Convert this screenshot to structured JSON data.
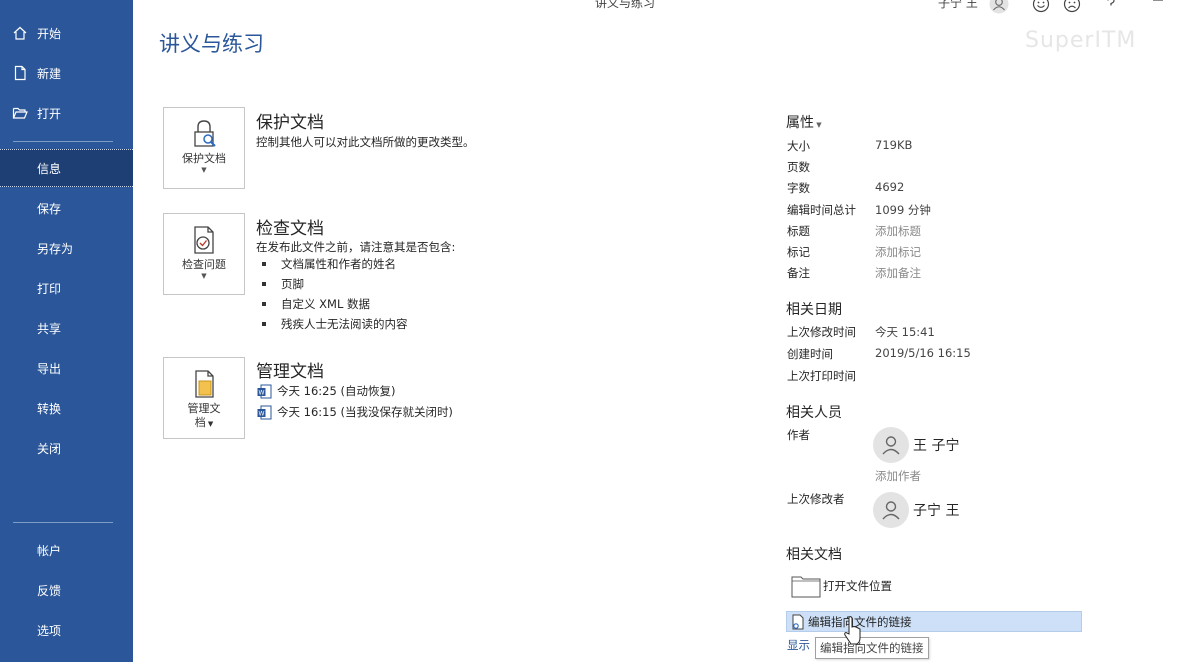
{
  "window": {
    "title": "讲义与练习",
    "user": "子宁 王",
    "watermark": "SuperITM"
  },
  "sidebar": {
    "top_items": [
      {
        "label": "开始",
        "icon": "home-icon"
      },
      {
        "label": "新建",
        "icon": "new-document-icon"
      },
      {
        "label": "打开",
        "icon": "open-folder-icon"
      }
    ],
    "items": [
      "信息",
      "保存",
      "另存为",
      "打印",
      "共享",
      "导出",
      "转换",
      "关闭"
    ],
    "active": "信息",
    "bottom_items": [
      "帐户",
      "反馈",
      "选项"
    ]
  },
  "page": {
    "title": "讲义与练习"
  },
  "protect": {
    "button_label": "保护文档",
    "heading": "保护文档",
    "description": "控制其他人可以对此文档所做的更改类型。"
  },
  "inspect": {
    "button_label": "检查问题",
    "heading": "检查文档",
    "description": "在发布此文件之前，请注意其是否包含:",
    "bullets": [
      "文档属性和作者的姓名",
      "页脚",
      "自定义 XML 数据",
      "残疾人士无法阅读的内容"
    ]
  },
  "manage": {
    "button_label_line1": "管理文",
    "button_label_line2": "档",
    "heading": "管理文档",
    "versions": [
      "今天 16:25 (自动恢复)",
      "今天 16:15 (当我没保存就关闭时)"
    ]
  },
  "properties": {
    "heading": "属性",
    "rows": [
      {
        "label": "大小",
        "value": "719KB"
      },
      {
        "label": "页数",
        "value": ""
      },
      {
        "label": "字数",
        "value": "4692"
      },
      {
        "label": "编辑时间总计",
        "value": "1099 分钟"
      },
      {
        "label": "标题",
        "value": "添加标题"
      },
      {
        "label": "标记",
        "value": "添加标记"
      },
      {
        "label": "备注",
        "value": "添加备注"
      }
    ]
  },
  "dates": {
    "heading": "相关日期",
    "rows": [
      {
        "label": "上次修改时间",
        "value": "今天 15:41"
      },
      {
        "label": "创建时间",
        "value": "2019/5/16 16:15"
      },
      {
        "label": "上次打印时间",
        "value": ""
      }
    ]
  },
  "people": {
    "heading": "相关人员",
    "author_label": "作者",
    "author_name": "王 子宁",
    "add_author": "添加作者",
    "modifier_label": "上次修改者",
    "modifier_name": "子宁 王"
  },
  "related_docs": {
    "heading": "相关文档",
    "open_location": "打开文件位置",
    "edit_link": "编辑指向文件的链接",
    "show_more": "显示",
    "tooltip": "编辑指向文件的链接"
  },
  "colors": {
    "sidebar": "#2b579a",
    "sidebar_active": "#1e3f73",
    "accent": "#2b579a",
    "highlight": "#cde0f7"
  }
}
